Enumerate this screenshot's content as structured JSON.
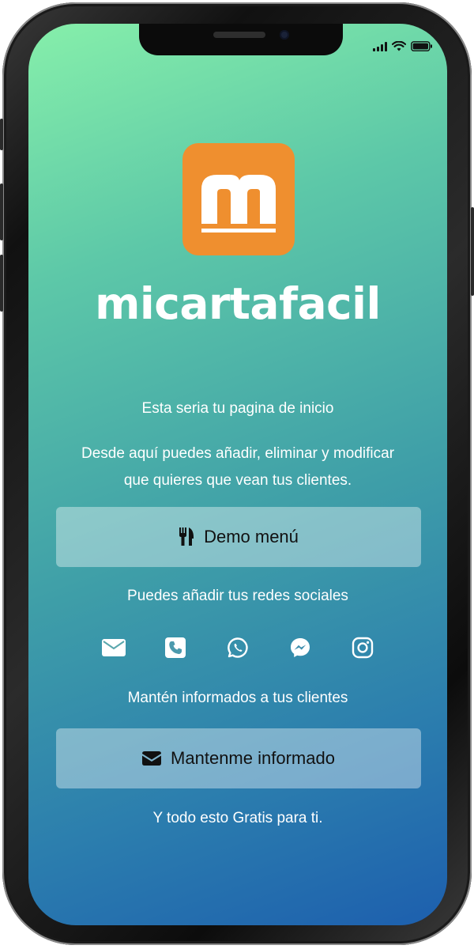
{
  "app": {
    "logo_letter": "m",
    "brand_name": "micartafacil"
  },
  "home": {
    "intro": "Esta seria tu pagina de inicio",
    "description_line1": "Desde aquí puedes añadir, eliminar y modificar",
    "description_line2": "que quieres que vean tus clientes.",
    "demo_button_label": "Demo menú",
    "socials_text": "Puedes añadir tus redes sociales",
    "social_icons": [
      "email-icon",
      "phone-icon",
      "whatsapp-icon",
      "messenger-icon",
      "instagram-icon"
    ],
    "inform_text": "Mantén informados a tus clientes",
    "inform_button_label": "Mantenme informado",
    "footer_text": "Y todo esto Gratis para ti."
  },
  "colors": {
    "logo_orange": "#ef8f2f",
    "gradient_start": "#86efaa",
    "gradient_end": "#1d5fae"
  }
}
